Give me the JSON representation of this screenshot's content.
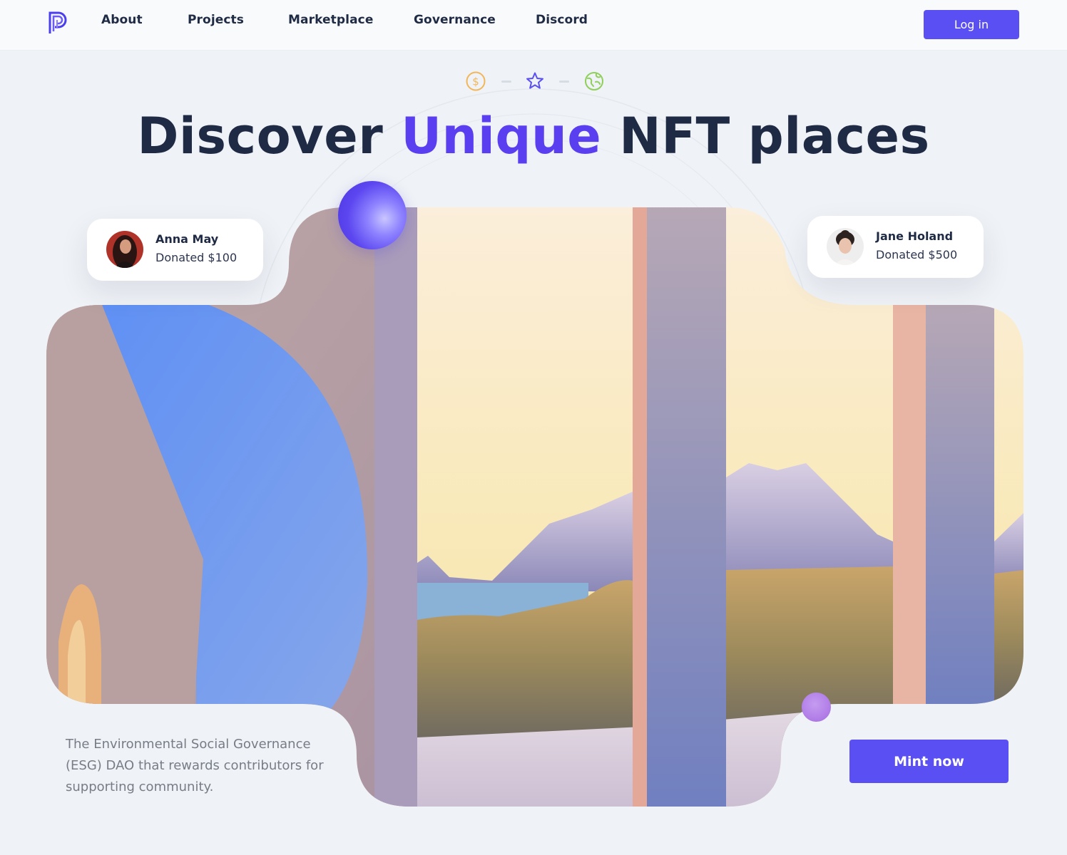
{
  "nav": {
    "links": [
      "About",
      "Projects",
      "Marketplace",
      "Governance",
      "Discord"
    ],
    "login_label": "Log in"
  },
  "hero": {
    "icons": [
      "dollar-coin-icon",
      "star-icon",
      "globe-icon"
    ],
    "headline_before": "Discover",
    "headline_accent": "Unique",
    "headline_after": "NFT places",
    "tagline": "The Environmental Social Governance (ESG) DAO that rewards contributors for supporting community.",
    "cta_label": "Mint now"
  },
  "donors": [
    {
      "name": "Anna May",
      "amount": "Donated $100"
    },
    {
      "name": "Jane Holand",
      "amount": "Donated $500"
    }
  ],
  "colors": {
    "accent": "#5a4ff3",
    "headline_accent": "#5a3ff0",
    "dark_text": "#1f2a44",
    "background": "#eff2f6"
  }
}
